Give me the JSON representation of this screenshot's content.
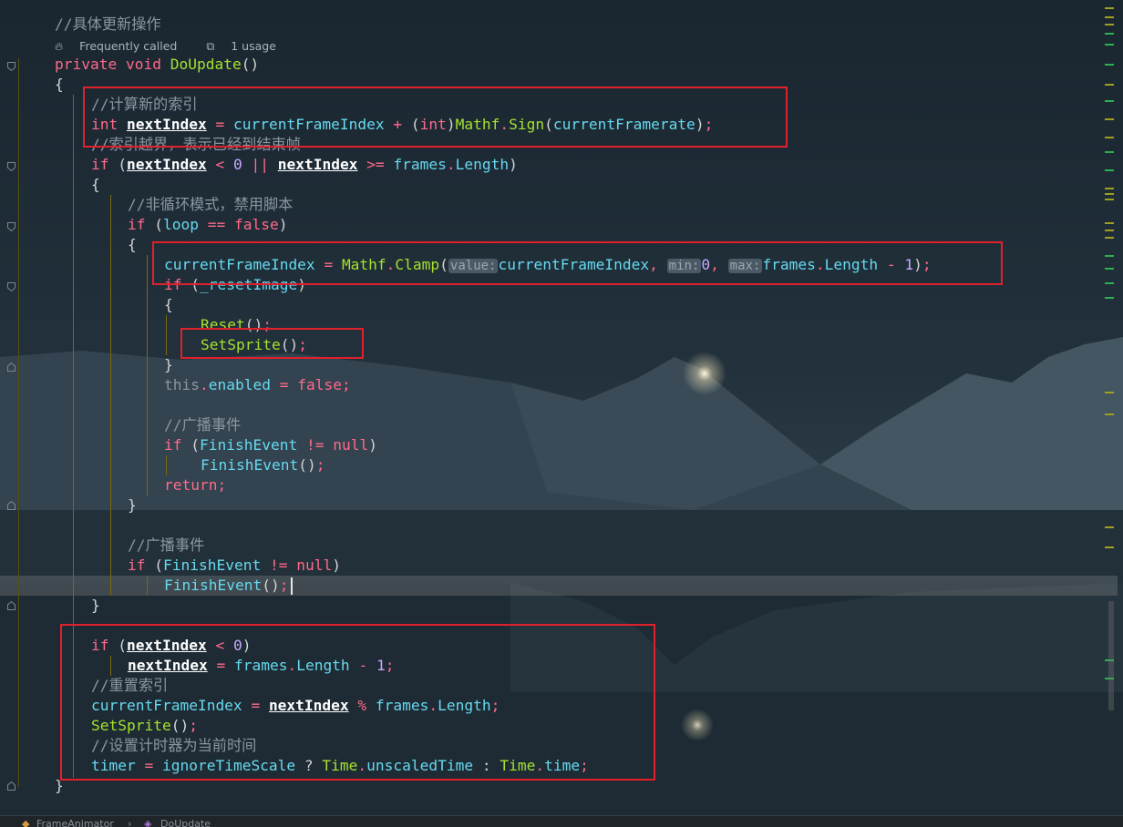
{
  "editor": {
    "hint_frequently_called": "Frequently called",
    "hint_usage": "1 usage",
    "comment_specific_update": "//具体更新操作",
    "method_name": "DoUpdate",
    "comment_calc_index": "//计算新的索引",
    "comment_out_of_bounds": "//索引越界，表示已经到结束帧",
    "comment_non_loop": "//非循环模式，禁用脚本",
    "comment_broadcast_1": "//广播事件",
    "comment_broadcast_2": "//广播事件",
    "comment_reset_index": "//重置索引",
    "comment_set_timer": "//设置计时器为当前时间",
    "param_hint_value": "value:",
    "param_hint_min": "min:",
    "param_hint_max": "max:"
  },
  "breadcrumb": {
    "class_name": "FrameAnimator",
    "method_name": "DoUpdate"
  }
}
